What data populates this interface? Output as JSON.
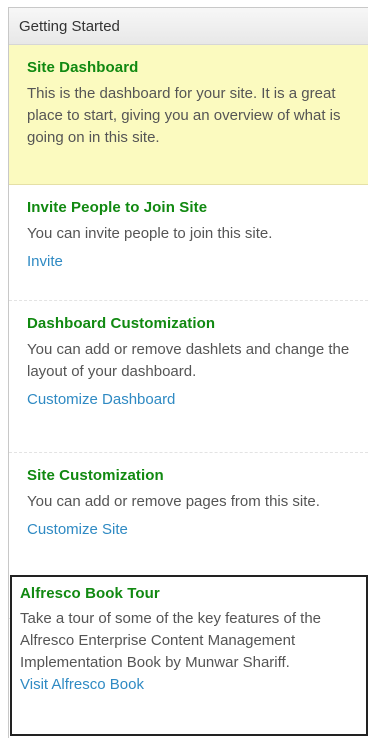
{
  "header": {
    "title": "Getting Started"
  },
  "sections": [
    {
      "title": "Site Dashboard",
      "desc": "This is the dashboard for your site. It is a great place to start, giving you an overview of what is going on in this site."
    },
    {
      "title": "Invite People to Join Site",
      "desc": "You can invite people to join this site.",
      "link": "Invite"
    },
    {
      "title": "Dashboard Customization",
      "desc": "You can add or remove dashlets and change the layout of your dashboard.",
      "link": "Customize Dashboard"
    },
    {
      "title": "Site Customization",
      "desc": "You can add or remove pages from this site.",
      "link": "Customize Site"
    },
    {
      "title": "Alfresco Book Tour",
      "desc": "Take a tour of some of the key features of the Alfresco Enterprise Content Management Implementation Book by Munwar Shariff.",
      "link": "Visit Alfresco Book"
    }
  ],
  "colors": {
    "title_green": "#118911",
    "link_blue": "#2f8ac3",
    "highlight_yellow": "#fbfabf",
    "selected_border": "#222222"
  }
}
